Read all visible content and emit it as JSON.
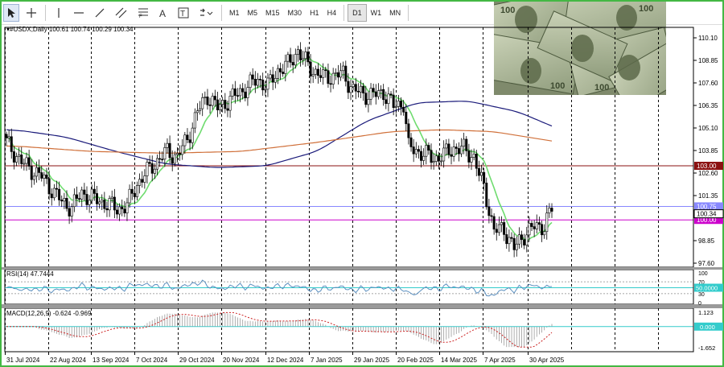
{
  "toolbar": {
    "timeframes": [
      "M1",
      "M5",
      "M15",
      "M30",
      "H1",
      "H4",
      "D1",
      "W1",
      "MN"
    ],
    "selected_timeframe": "D1"
  },
  "chart": {
    "header": "▾#USDX,Daily  100.61 100.74 100.29 100.34",
    "price_axis": [
      "110.10",
      "108.85",
      "107.60",
      "106.35",
      "105.10",
      "103.85",
      "102.60",
      "101.35",
      "98.85",
      "97.60"
    ],
    "level_tags": {
      "resistance": "103.00",
      "upper": "100.75",
      "last": "100.34",
      "support": "100.00"
    },
    "date_axis": [
      "31 Jul 2024",
      "22 Aug 2024",
      "13 Sep 2024",
      "7 Oct 2024",
      "29 Oct 2024",
      "20 Nov 2024",
      "12 Dec 2024",
      "7 Jan 2025",
      "29 Jan 2025",
      "20 Feb 2025",
      "14 Mar 2025",
      "7 Apr 2025",
      "30 Apr 2025"
    ]
  },
  "rsi": {
    "label": "RSI(14) 47.7444",
    "axis": [
      "100",
      "70",
      "30",
      "0"
    ],
    "level_tag": "50.0000"
  },
  "macd": {
    "label": "MACD(12,26,9) -0.624 -0.969",
    "axis": [
      "1.123",
      "-1.652"
    ],
    "level_tag": "0.000"
  },
  "colors": {
    "frame": "#44b844",
    "grid": "#000000",
    "fast_ma": "#6fdc6f",
    "slow_ma": "#1a1a7a",
    "long_ma": "#d0703a",
    "resistance": "#8b1010",
    "support": "#cc00cc",
    "upper_level": "#8888ff",
    "rsi_line": "#5b8fbf",
    "rsi_level": "#33cccc",
    "macd_signal": "#cc2222",
    "macd_zero": "#33cccc"
  }
}
